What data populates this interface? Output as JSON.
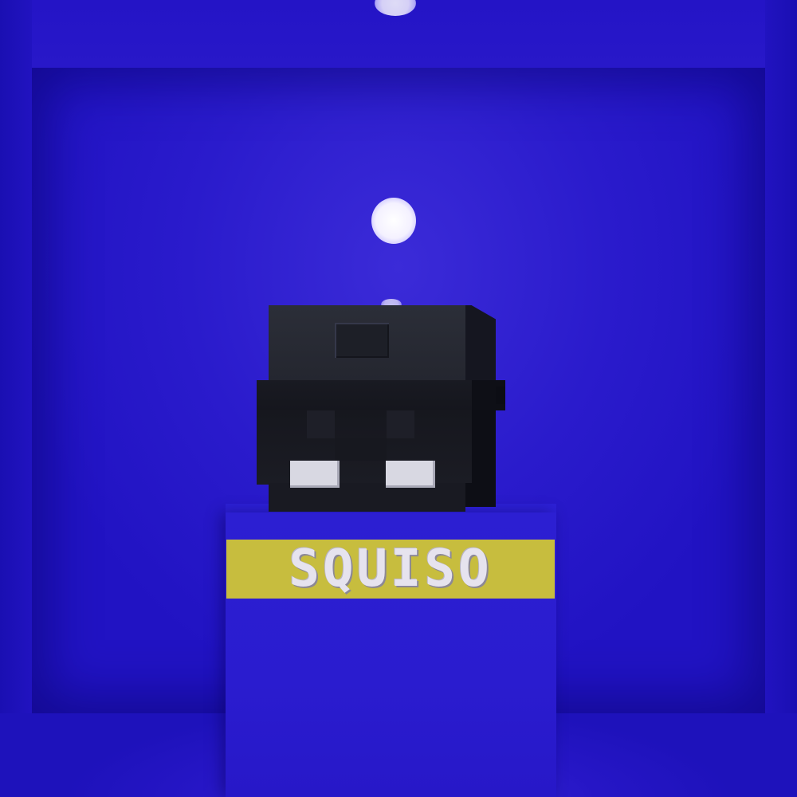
{
  "scene": {
    "name_plate_text": "SQUISO",
    "background_color": "#2a1ccb",
    "plate_color": "#c7bd3e",
    "helmet_color": "#1b1c24"
  }
}
